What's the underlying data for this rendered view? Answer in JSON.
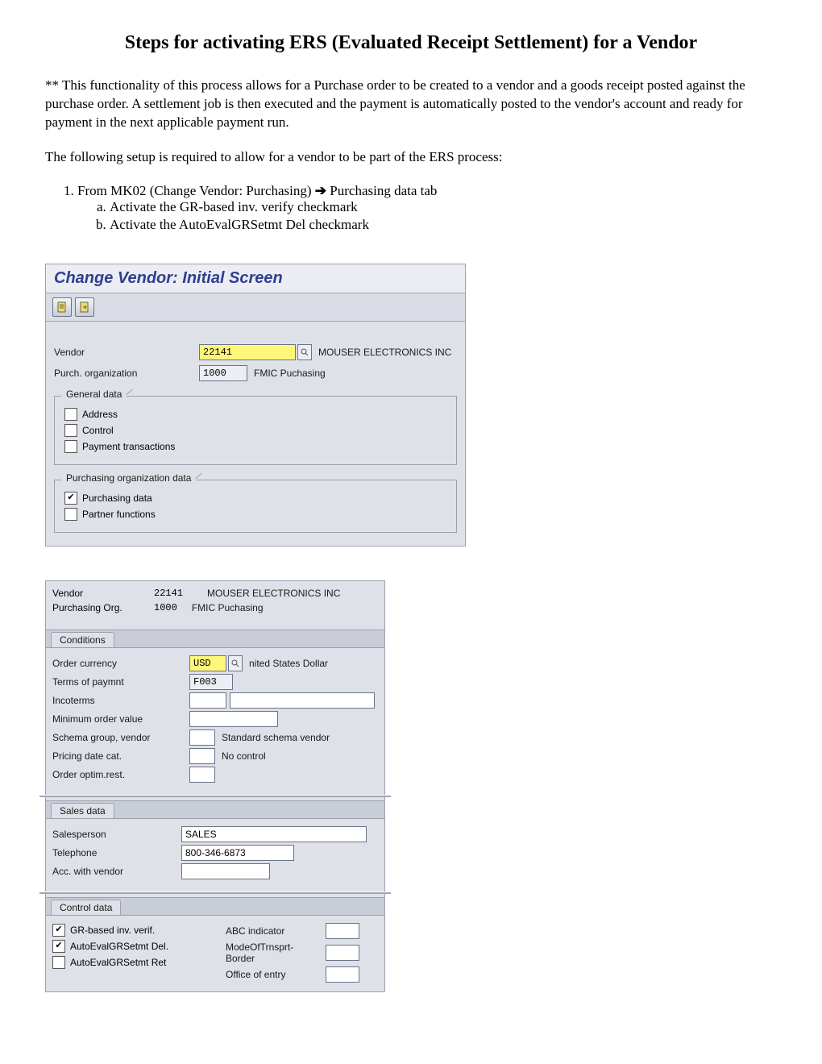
{
  "title": "Steps for activating ERS (Evaluated Receipt Settlement) for a Vendor",
  "intro1": "** This functionality of this process allows for a Purchase order to be created to a vendor and a goods receipt posted against the purchase order. A settlement job is then executed and the payment is automatically posted to the vendor's account and ready for payment in the next applicable payment run.",
  "intro2": "The following setup is required to allow for a vendor to be part of the ERS process:",
  "step1_pre": "From MK02 (Change Vendor: Purchasing) ",
  "step1_post": " Purchasing data tab",
  "step1a": "Activate the GR-based inv. verify checkmark",
  "step1b": "Activate the AutoEvalGRSetmt Del checkmark",
  "sap1": {
    "title": "Change Vendor:  Initial Screen",
    "vendor_label": "Vendor",
    "vendor_value": "22141",
    "vendor_name": "MOUSER ELECTRONICS INC",
    "porg_label": "Purch. organization",
    "porg_value": "1000",
    "porg_name": "FMIC Puchasing",
    "group1": "General data",
    "g1_a": "Address",
    "g1_b": "Control",
    "g1_c": "Payment transactions",
    "group2": "Purchasing organization data",
    "g2_a": "Purchasing data",
    "g2_b": "Partner functions"
  },
  "sap2": {
    "hdr_vendor_l": "Vendor",
    "hdr_vendor_v": "22141",
    "hdr_vendor_n": "MOUSER ELECTRONICS INC",
    "hdr_porg_l": "Purchasing Org.",
    "hdr_porg_v": "1000",
    "hdr_porg_n": "FMIC Puchasing",
    "tab_cond": "Conditions",
    "oc_l": "Order currency",
    "oc_v": "USD",
    "oc_n": "nited States Dollar",
    "top_l": "Terms of paymnt",
    "top_v": "F003",
    "inc_l": "Incoterms",
    "mov_l": "Minimum order value",
    "sgv_l": "Schema group, vendor",
    "sgv_v": "Standard schema vendor",
    "pdc_l": "Pricing date cat.",
    "pdc_v": "No control",
    "oor_l": "Order optim.rest.",
    "tab_sales": "Sales data",
    "sp_l": "Salesperson",
    "sp_v": "SALES",
    "tel_l": "Telephone",
    "tel_v": "800-346-6873",
    "awv_l": "Acc. with vendor",
    "tab_ctrl": "Control data",
    "cd_a": "GR-based inv. verif.",
    "cd_b": "AutoEvalGRSetmt Del.",
    "cd_c": "AutoEvalGRSetmt Ret",
    "cd_r1": "ABC indicator",
    "cd_r2": "ModeOfTrnsprt-Border",
    "cd_r3": "Office of entry"
  }
}
